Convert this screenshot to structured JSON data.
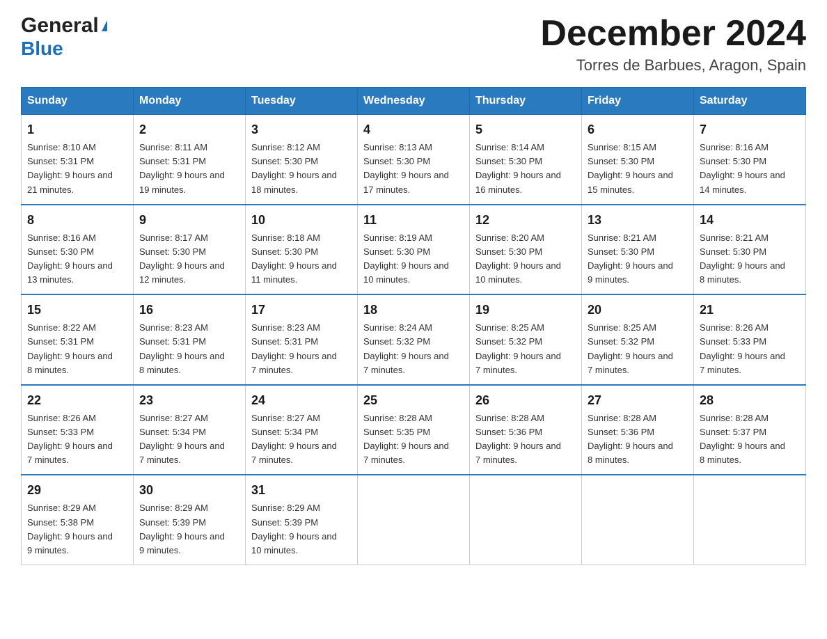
{
  "header": {
    "logo_line1": "General",
    "logo_line2": "Blue",
    "month_year": "December 2024",
    "location": "Torres de Barbues, Aragon, Spain"
  },
  "weekdays": [
    "Sunday",
    "Monday",
    "Tuesday",
    "Wednesday",
    "Thursday",
    "Friday",
    "Saturday"
  ],
  "weeks": [
    [
      {
        "day": "1",
        "sunrise": "8:10 AM",
        "sunset": "5:31 PM",
        "daylight": "9 hours and 21 minutes."
      },
      {
        "day": "2",
        "sunrise": "8:11 AM",
        "sunset": "5:31 PM",
        "daylight": "9 hours and 19 minutes."
      },
      {
        "day": "3",
        "sunrise": "8:12 AM",
        "sunset": "5:30 PM",
        "daylight": "9 hours and 18 minutes."
      },
      {
        "day": "4",
        "sunrise": "8:13 AM",
        "sunset": "5:30 PM",
        "daylight": "9 hours and 17 minutes."
      },
      {
        "day": "5",
        "sunrise": "8:14 AM",
        "sunset": "5:30 PM",
        "daylight": "9 hours and 16 minutes."
      },
      {
        "day": "6",
        "sunrise": "8:15 AM",
        "sunset": "5:30 PM",
        "daylight": "9 hours and 15 minutes."
      },
      {
        "day": "7",
        "sunrise": "8:16 AM",
        "sunset": "5:30 PM",
        "daylight": "9 hours and 14 minutes."
      }
    ],
    [
      {
        "day": "8",
        "sunrise": "8:16 AM",
        "sunset": "5:30 PM",
        "daylight": "9 hours and 13 minutes."
      },
      {
        "day": "9",
        "sunrise": "8:17 AM",
        "sunset": "5:30 PM",
        "daylight": "9 hours and 12 minutes."
      },
      {
        "day": "10",
        "sunrise": "8:18 AM",
        "sunset": "5:30 PM",
        "daylight": "9 hours and 11 minutes."
      },
      {
        "day": "11",
        "sunrise": "8:19 AM",
        "sunset": "5:30 PM",
        "daylight": "9 hours and 10 minutes."
      },
      {
        "day": "12",
        "sunrise": "8:20 AM",
        "sunset": "5:30 PM",
        "daylight": "9 hours and 10 minutes."
      },
      {
        "day": "13",
        "sunrise": "8:21 AM",
        "sunset": "5:30 PM",
        "daylight": "9 hours and 9 minutes."
      },
      {
        "day": "14",
        "sunrise": "8:21 AM",
        "sunset": "5:30 PM",
        "daylight": "9 hours and 8 minutes."
      }
    ],
    [
      {
        "day": "15",
        "sunrise": "8:22 AM",
        "sunset": "5:31 PM",
        "daylight": "9 hours and 8 minutes."
      },
      {
        "day": "16",
        "sunrise": "8:23 AM",
        "sunset": "5:31 PM",
        "daylight": "9 hours and 8 minutes."
      },
      {
        "day": "17",
        "sunrise": "8:23 AM",
        "sunset": "5:31 PM",
        "daylight": "9 hours and 7 minutes."
      },
      {
        "day": "18",
        "sunrise": "8:24 AM",
        "sunset": "5:32 PM",
        "daylight": "9 hours and 7 minutes."
      },
      {
        "day": "19",
        "sunrise": "8:25 AM",
        "sunset": "5:32 PM",
        "daylight": "9 hours and 7 minutes."
      },
      {
        "day": "20",
        "sunrise": "8:25 AM",
        "sunset": "5:32 PM",
        "daylight": "9 hours and 7 minutes."
      },
      {
        "day": "21",
        "sunrise": "8:26 AM",
        "sunset": "5:33 PM",
        "daylight": "9 hours and 7 minutes."
      }
    ],
    [
      {
        "day": "22",
        "sunrise": "8:26 AM",
        "sunset": "5:33 PM",
        "daylight": "9 hours and 7 minutes."
      },
      {
        "day": "23",
        "sunrise": "8:27 AM",
        "sunset": "5:34 PM",
        "daylight": "9 hours and 7 minutes."
      },
      {
        "day": "24",
        "sunrise": "8:27 AM",
        "sunset": "5:34 PM",
        "daylight": "9 hours and 7 minutes."
      },
      {
        "day": "25",
        "sunrise": "8:28 AM",
        "sunset": "5:35 PM",
        "daylight": "9 hours and 7 minutes."
      },
      {
        "day": "26",
        "sunrise": "8:28 AM",
        "sunset": "5:36 PM",
        "daylight": "9 hours and 7 minutes."
      },
      {
        "day": "27",
        "sunrise": "8:28 AM",
        "sunset": "5:36 PM",
        "daylight": "9 hours and 8 minutes."
      },
      {
        "day": "28",
        "sunrise": "8:28 AM",
        "sunset": "5:37 PM",
        "daylight": "9 hours and 8 minutes."
      }
    ],
    [
      {
        "day": "29",
        "sunrise": "8:29 AM",
        "sunset": "5:38 PM",
        "daylight": "9 hours and 9 minutes."
      },
      {
        "day": "30",
        "sunrise": "8:29 AM",
        "sunset": "5:39 PM",
        "daylight": "9 hours and 9 minutes."
      },
      {
        "day": "31",
        "sunrise": "8:29 AM",
        "sunset": "5:39 PM",
        "daylight": "9 hours and 10 minutes."
      },
      null,
      null,
      null,
      null
    ]
  ]
}
